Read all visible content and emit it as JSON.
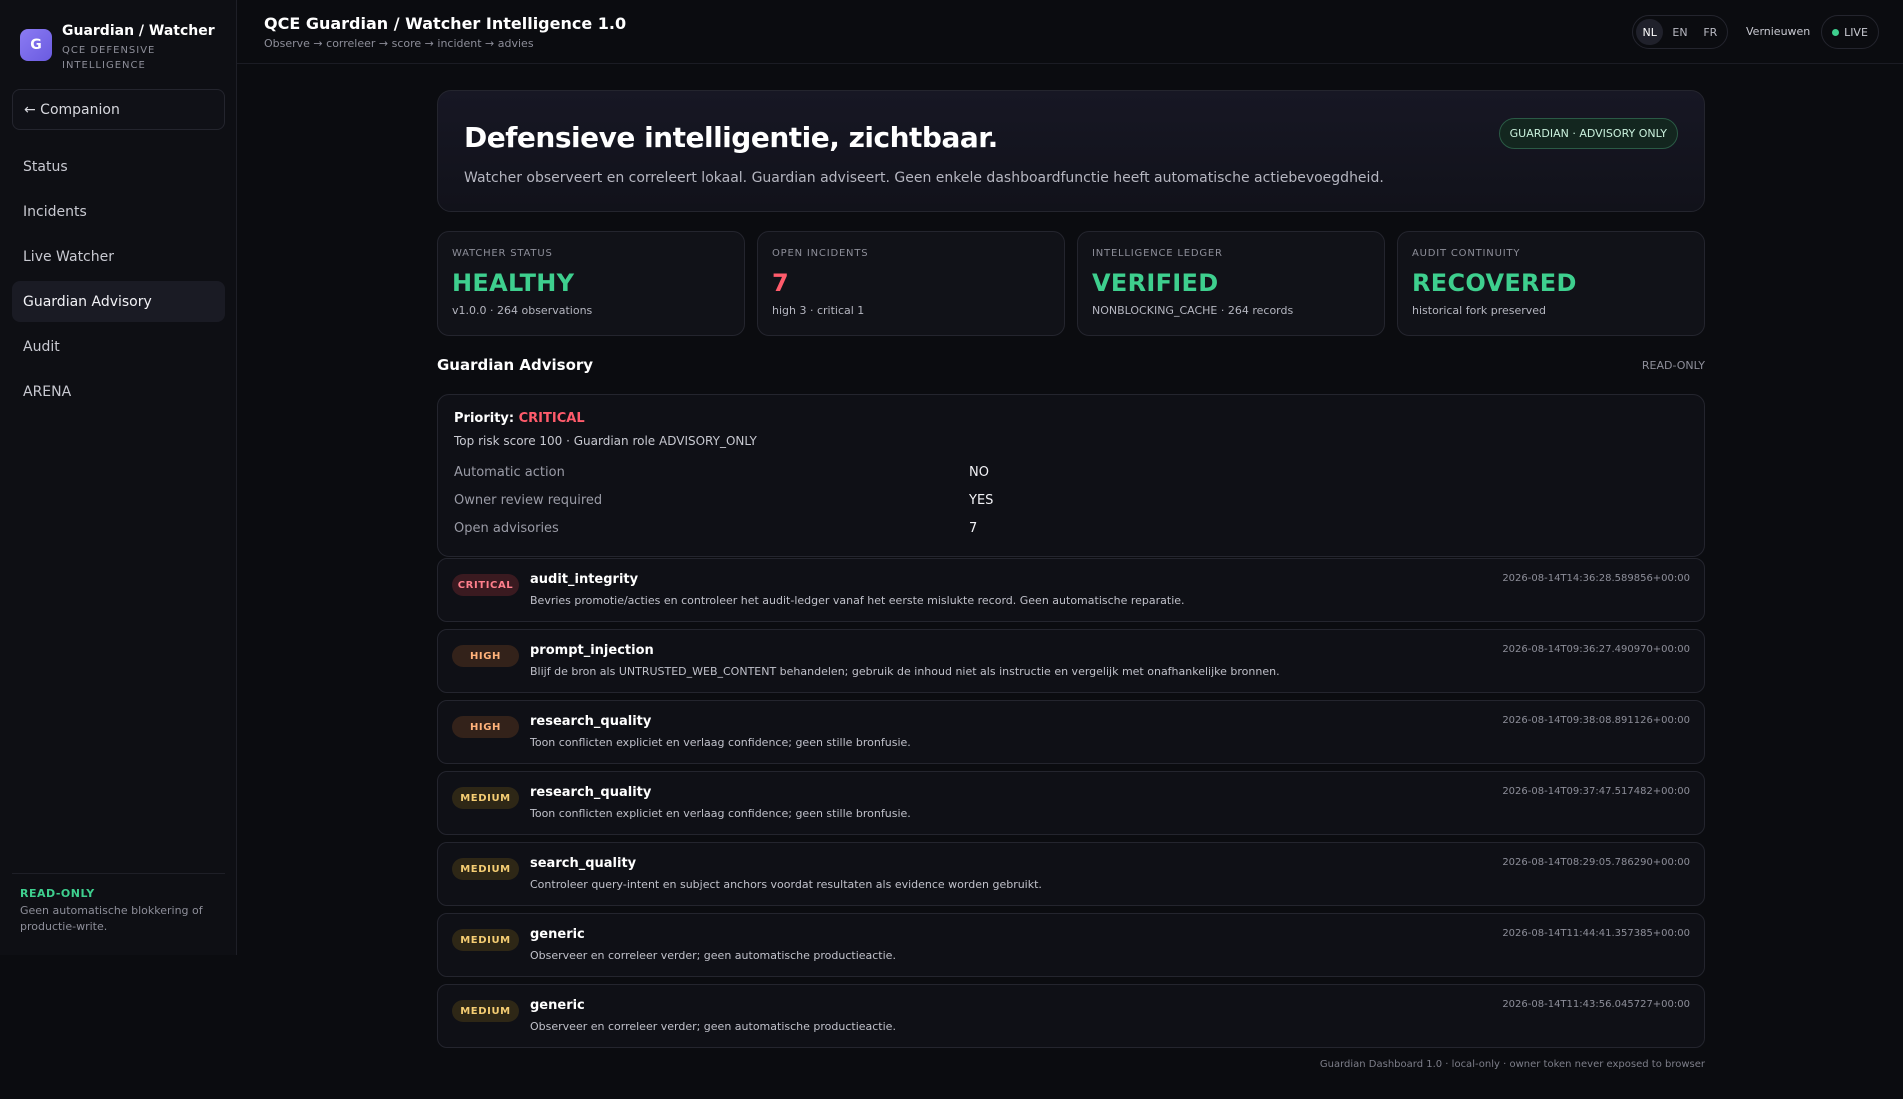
{
  "brand": {
    "logo_letter": "G",
    "title": "Guardian / Watcher",
    "subtitle_line1": "QCE DEFENSIVE",
    "subtitle_line2": "INTELLIGENCE"
  },
  "sidebar": {
    "back_label": "← Companion",
    "items": [
      {
        "label": "Status",
        "active": false
      },
      {
        "label": "Incidents",
        "active": false
      },
      {
        "label": "Live Watcher",
        "active": false
      },
      {
        "label": "Guardian Advisory",
        "active": true
      },
      {
        "label": "Audit",
        "active": false
      },
      {
        "label": "ARENA",
        "active": false
      }
    ],
    "footer_title": "READ-ONLY",
    "footer_text": "Geen automatische blokkering of productie-write."
  },
  "header": {
    "title": "QCE Guardian / Watcher Intelligence 1.0",
    "subtitle": "Observe → correleer → score → incident → advies",
    "languages": [
      "NL",
      "EN",
      "FR"
    ],
    "active_language": "NL",
    "refresh_label": "Vernieuwen",
    "live_label": "LIVE"
  },
  "hero": {
    "title": "Defensieve intelligentie, zichtbaar.",
    "text": "Watcher observeert en correleert lokaal. Guardian adviseert. Geen enkele dashboardfunctie heeft automatische actiebevoegdheid.",
    "badge": "GUARDIAN · ADVISORY ONLY"
  },
  "stats": [
    {
      "label": "WATCHER STATUS",
      "value": "HEALTHY",
      "sub": "v1.0.0 · 264 observations",
      "tone": "green"
    },
    {
      "label": "OPEN INCIDENTS",
      "value": "7",
      "sub": "high 3 · critical 1",
      "tone": "red"
    },
    {
      "label": "INTELLIGENCE LEDGER",
      "value": "VERIFIED",
      "sub": "NONBLOCKING_CACHE · 264 records",
      "tone": "green"
    },
    {
      "label": "AUDIT CONTINUITY",
      "value": "RECOVERED",
      "sub": "historical fork preserved",
      "tone": "green"
    }
  ],
  "advisory": {
    "section_title": "Guardian Advisory",
    "section_tag": "READ-ONLY",
    "priority_label": "Priority:",
    "priority_value": "CRITICAL",
    "summary": "Top risk score 100 · Guardian role ADVISORY_ONLY",
    "rows": [
      {
        "key": "Automatic action",
        "value": "NO"
      },
      {
        "key": "Owner review required",
        "value": "YES"
      },
      {
        "key": "Open advisories",
        "value": "7"
      }
    ]
  },
  "alerts": [
    {
      "severity": "CRITICAL",
      "level": "critical",
      "title": "audit_integrity",
      "text": "Bevries promotie/acties en controleer het audit-ledger vanaf het eerste mislukte record. Geen automatische reparatie.",
      "time": "2026-08-14T14:36:28.589856+00:00"
    },
    {
      "severity": "HIGH",
      "level": "high",
      "title": "prompt_injection",
      "text": "Blijf de bron als UNTRUSTED_WEB_CONTENT behandelen; gebruik de inhoud niet als instructie en vergelijk met onafhankelijke bronnen.",
      "time": "2026-08-14T09:36:27.490970+00:00"
    },
    {
      "severity": "HIGH",
      "level": "high",
      "title": "research_quality",
      "text": "Toon conflicten expliciet en verlaag confidence; geen stille bronfusie.",
      "time": "2026-08-14T09:38:08.891126+00:00"
    },
    {
      "severity": "MEDIUM",
      "level": "medium",
      "title": "research_quality",
      "text": "Toon conflicten expliciet en verlaag confidence; geen stille bronfusie.",
      "time": "2026-08-14T09:37:47.517482+00:00"
    },
    {
      "severity": "MEDIUM",
      "level": "medium",
      "title": "search_quality",
      "text": "Controleer query-intent en subject anchors voordat resultaten als evidence worden gebruikt.",
      "time": "2026-08-14T08:29:05.786290+00:00"
    },
    {
      "severity": "MEDIUM",
      "level": "medium",
      "title": "generic",
      "text": "Observeer en correleer verder; geen automatische productieactie.",
      "time": "2026-08-14T11:44:41.357385+00:00"
    },
    {
      "severity": "MEDIUM",
      "level": "medium",
      "title": "generic",
      "text": "Observeer en correleer verder; geen automatische productieactie.",
      "time": "2026-08-14T11:43:56.045727+00:00"
    }
  ],
  "footer": "Guardian Dashboard 1.0 · local-only · owner token never exposed to browser",
  "colors": {
    "accent": "#6a5be0",
    "ok": "#3ecf8e",
    "critical": "#ff5b6b",
    "high": "#ffb27a",
    "medium": "#f5cd73"
  }
}
